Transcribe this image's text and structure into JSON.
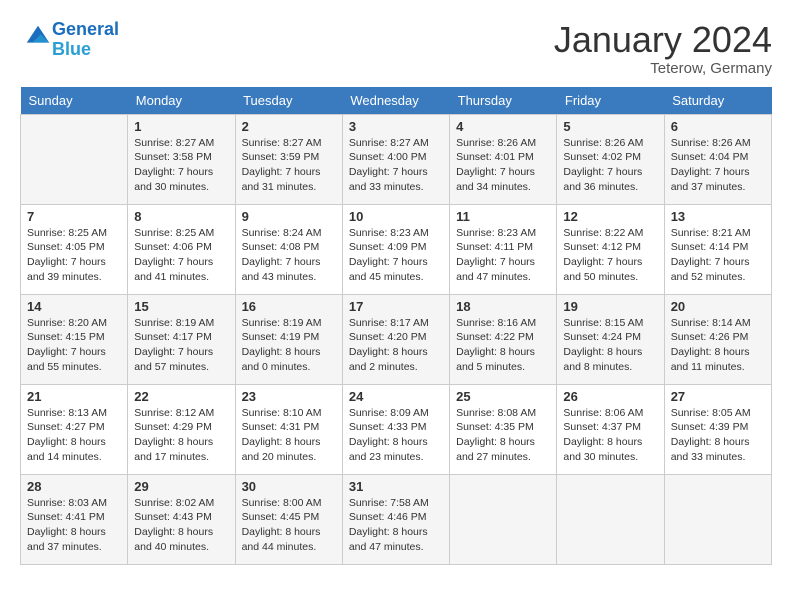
{
  "logo": {
    "line1": "General",
    "line2": "Blue"
  },
  "title": "January 2024",
  "subtitle": "Teterow, Germany",
  "days_of_week": [
    "Sunday",
    "Monday",
    "Tuesday",
    "Wednesday",
    "Thursday",
    "Friday",
    "Saturday"
  ],
  "weeks": [
    [
      {
        "day": "",
        "sunrise": "",
        "sunset": "",
        "daylight": ""
      },
      {
        "day": "1",
        "sunrise": "8:27 AM",
        "sunset": "3:58 PM",
        "daylight": "7 hours and 30 minutes."
      },
      {
        "day": "2",
        "sunrise": "8:27 AM",
        "sunset": "3:59 PM",
        "daylight": "7 hours and 31 minutes."
      },
      {
        "day": "3",
        "sunrise": "8:27 AM",
        "sunset": "4:00 PM",
        "daylight": "7 hours and 33 minutes."
      },
      {
        "day": "4",
        "sunrise": "8:26 AM",
        "sunset": "4:01 PM",
        "daylight": "7 hours and 34 minutes."
      },
      {
        "day": "5",
        "sunrise": "8:26 AM",
        "sunset": "4:02 PM",
        "daylight": "7 hours and 36 minutes."
      },
      {
        "day": "6",
        "sunrise": "8:26 AM",
        "sunset": "4:04 PM",
        "daylight": "7 hours and 37 minutes."
      }
    ],
    [
      {
        "day": "7",
        "sunrise": "8:25 AM",
        "sunset": "4:05 PM",
        "daylight": "7 hours and 39 minutes."
      },
      {
        "day": "8",
        "sunrise": "8:25 AM",
        "sunset": "4:06 PM",
        "daylight": "7 hours and 41 minutes."
      },
      {
        "day": "9",
        "sunrise": "8:24 AM",
        "sunset": "4:08 PM",
        "daylight": "7 hours and 43 minutes."
      },
      {
        "day": "10",
        "sunrise": "8:23 AM",
        "sunset": "4:09 PM",
        "daylight": "7 hours and 45 minutes."
      },
      {
        "day": "11",
        "sunrise": "8:23 AM",
        "sunset": "4:11 PM",
        "daylight": "7 hours and 47 minutes."
      },
      {
        "day": "12",
        "sunrise": "8:22 AM",
        "sunset": "4:12 PM",
        "daylight": "7 hours and 50 minutes."
      },
      {
        "day": "13",
        "sunrise": "8:21 AM",
        "sunset": "4:14 PM",
        "daylight": "7 hours and 52 minutes."
      }
    ],
    [
      {
        "day": "14",
        "sunrise": "8:20 AM",
        "sunset": "4:15 PM",
        "daylight": "7 hours and 55 minutes."
      },
      {
        "day": "15",
        "sunrise": "8:19 AM",
        "sunset": "4:17 PM",
        "daylight": "7 hours and 57 minutes."
      },
      {
        "day": "16",
        "sunrise": "8:19 AM",
        "sunset": "4:19 PM",
        "daylight": "8 hours and 0 minutes."
      },
      {
        "day": "17",
        "sunrise": "8:17 AM",
        "sunset": "4:20 PM",
        "daylight": "8 hours and 2 minutes."
      },
      {
        "day": "18",
        "sunrise": "8:16 AM",
        "sunset": "4:22 PM",
        "daylight": "8 hours and 5 minutes."
      },
      {
        "day": "19",
        "sunrise": "8:15 AM",
        "sunset": "4:24 PM",
        "daylight": "8 hours and 8 minutes."
      },
      {
        "day": "20",
        "sunrise": "8:14 AM",
        "sunset": "4:26 PM",
        "daylight": "8 hours and 11 minutes."
      }
    ],
    [
      {
        "day": "21",
        "sunrise": "8:13 AM",
        "sunset": "4:27 PM",
        "daylight": "8 hours and 14 minutes."
      },
      {
        "day": "22",
        "sunrise": "8:12 AM",
        "sunset": "4:29 PM",
        "daylight": "8 hours and 17 minutes."
      },
      {
        "day": "23",
        "sunrise": "8:10 AM",
        "sunset": "4:31 PM",
        "daylight": "8 hours and 20 minutes."
      },
      {
        "day": "24",
        "sunrise": "8:09 AM",
        "sunset": "4:33 PM",
        "daylight": "8 hours and 23 minutes."
      },
      {
        "day": "25",
        "sunrise": "8:08 AM",
        "sunset": "4:35 PM",
        "daylight": "8 hours and 27 minutes."
      },
      {
        "day": "26",
        "sunrise": "8:06 AM",
        "sunset": "4:37 PM",
        "daylight": "8 hours and 30 minutes."
      },
      {
        "day": "27",
        "sunrise": "8:05 AM",
        "sunset": "4:39 PM",
        "daylight": "8 hours and 33 minutes."
      }
    ],
    [
      {
        "day": "28",
        "sunrise": "8:03 AM",
        "sunset": "4:41 PM",
        "daylight": "8 hours and 37 minutes."
      },
      {
        "day": "29",
        "sunrise": "8:02 AM",
        "sunset": "4:43 PM",
        "daylight": "8 hours and 40 minutes."
      },
      {
        "day": "30",
        "sunrise": "8:00 AM",
        "sunset": "4:45 PM",
        "daylight": "8 hours and 44 minutes."
      },
      {
        "day": "31",
        "sunrise": "7:58 AM",
        "sunset": "4:46 PM",
        "daylight": "8 hours and 47 minutes."
      },
      {
        "day": "",
        "sunrise": "",
        "sunset": "",
        "daylight": ""
      },
      {
        "day": "",
        "sunrise": "",
        "sunset": "",
        "daylight": ""
      },
      {
        "day": "",
        "sunrise": "",
        "sunset": "",
        "daylight": ""
      }
    ]
  ],
  "labels": {
    "sunrise": "Sunrise:",
    "sunset": "Sunset:",
    "daylight": "Daylight:"
  }
}
